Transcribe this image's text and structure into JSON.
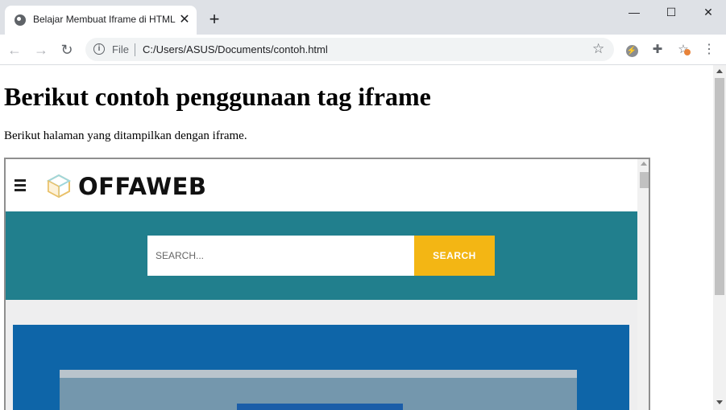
{
  "browser": {
    "tab": {
      "title": "Belajar Membuat Iframe di HTML",
      "close": "✕"
    },
    "new_tab": "+",
    "window": {
      "minimize": "—",
      "maximize": "☐",
      "close": "✕"
    },
    "nav": {
      "back": "←",
      "forward": "→",
      "reload": "↻"
    },
    "omnibox": {
      "scheme_label": "File",
      "url": "C:/Users/ASUS/Documents/contoh.html"
    }
  },
  "page": {
    "heading": "Berikut contoh penggunaan tag iframe",
    "paragraph": "Berikut halaman yang ditampilkan dengan iframe."
  },
  "iframe": {
    "logo_text": "OFFAWEB",
    "search": {
      "placeholder": "SEARCH...",
      "button_label": "SEARCH"
    },
    "colors": {
      "band": "#217f8d",
      "search_button": "#f3b614",
      "image": "#0e65a8"
    }
  },
  "icons": {
    "globe": "globe-icon",
    "info": "info-icon",
    "star": "star-icon",
    "extension": "puzzle-icon",
    "menu": "kebab-menu-icon",
    "hamburger": "hamburger-icon",
    "logo": "cube-logo-icon"
  }
}
